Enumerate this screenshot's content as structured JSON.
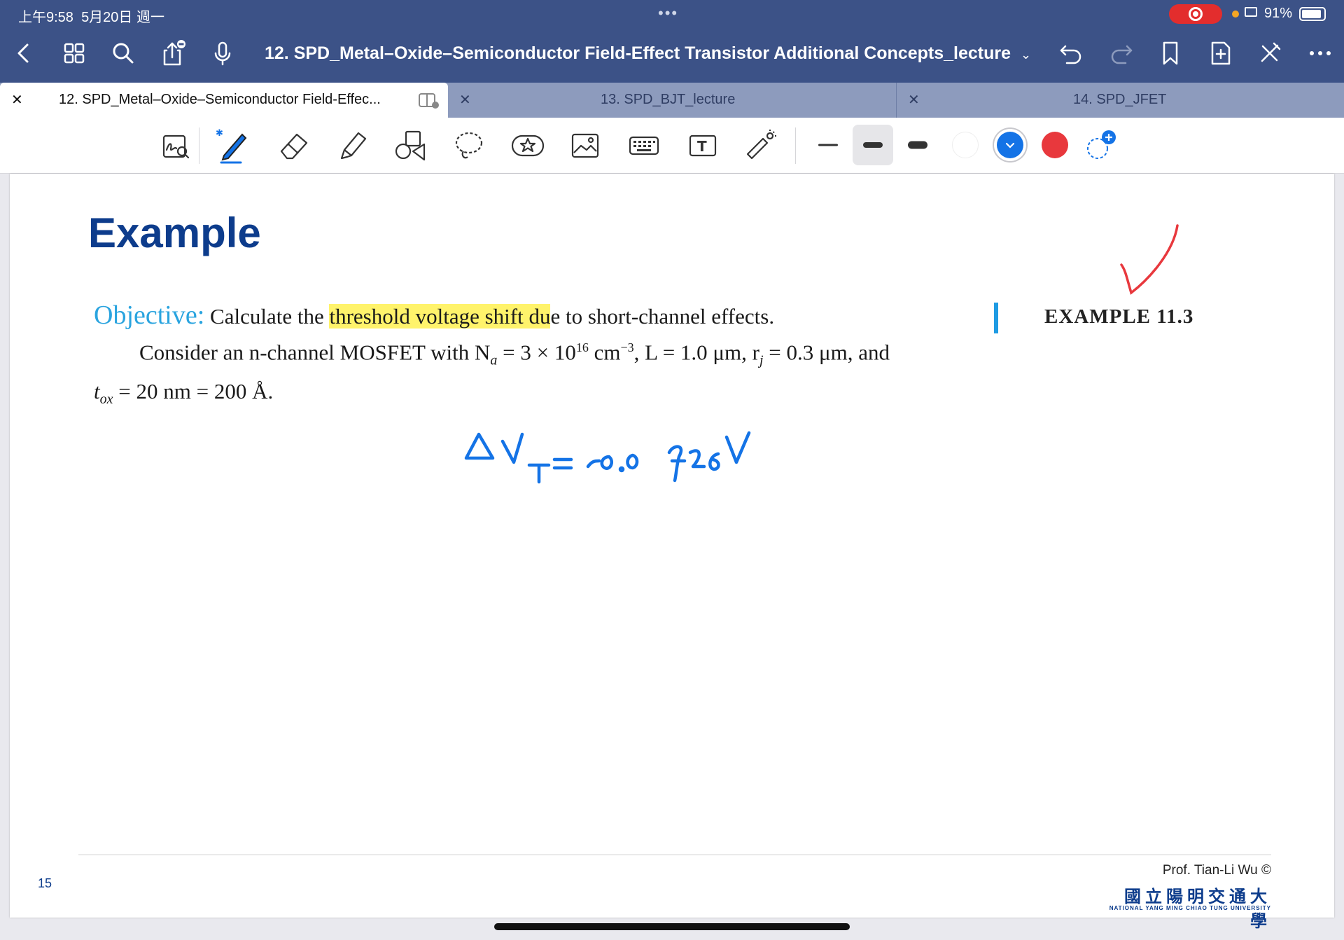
{
  "status": {
    "time": "上午9:58",
    "date": "5月20日 週一",
    "battery": "91%",
    "battery_level": 0.91
  },
  "nav": {
    "title": "12. SPD_Metal–Oxide–Semiconductor Field-Effect Transistor Additional Concepts_lecture",
    "chevron": "⌄"
  },
  "tabs": [
    {
      "label": "12. SPD_Metal–Oxide–Semiconductor Field-Effec...",
      "active": true
    },
    {
      "label": "13. SPD_BJT_lecture",
      "active": false
    },
    {
      "label": "14. SPD_JFET",
      "active": false
    }
  ],
  "toolbar": {
    "tools": [
      "zoom-writing-icon",
      "pen-icon",
      "eraser-icon",
      "highlighter-icon",
      "shapes-icon",
      "lasso-icon",
      "sticker-icon",
      "image-icon",
      "keyboard-icon",
      "text-icon",
      "laser-pointer-icon"
    ],
    "colors": {
      "white": "#ffffff",
      "blue": "#1473e6",
      "red": "#e8383d"
    }
  },
  "slide": {
    "title": "Example",
    "objective_label": "Objective:",
    "objective_pre": "Calculate the ",
    "objective_highlight": "threshold voltage shift du",
    "objective_post": "e to short-channel effects.",
    "line2": "Consider an n-channel MOSFET with N",
    "line2_sub": "a",
    "line2_b": " = 3 × 10",
    "line2_sup": "16",
    "line2_c": " cm",
    "line2_sup2": "−3",
    "line2_d": ", L = 1.0 μm, r",
    "line2_sub2": "j",
    "line2_e": " = 0.3 μm, and",
    "line3_t": "t",
    "line3_sub": "ox",
    "line3_rest": " = 20 nm = 200 Å.",
    "example_label": "EXAMPLE 11.3",
    "handwriting": "ΔV_T = -0.0726V",
    "page_number": "15",
    "professor": "Prof. Tian-Li Wu ©",
    "university_zh": "國立陽明交通大學",
    "university_en": "NATIONAL YANG MING CHIAO TUNG UNIVERSITY"
  }
}
